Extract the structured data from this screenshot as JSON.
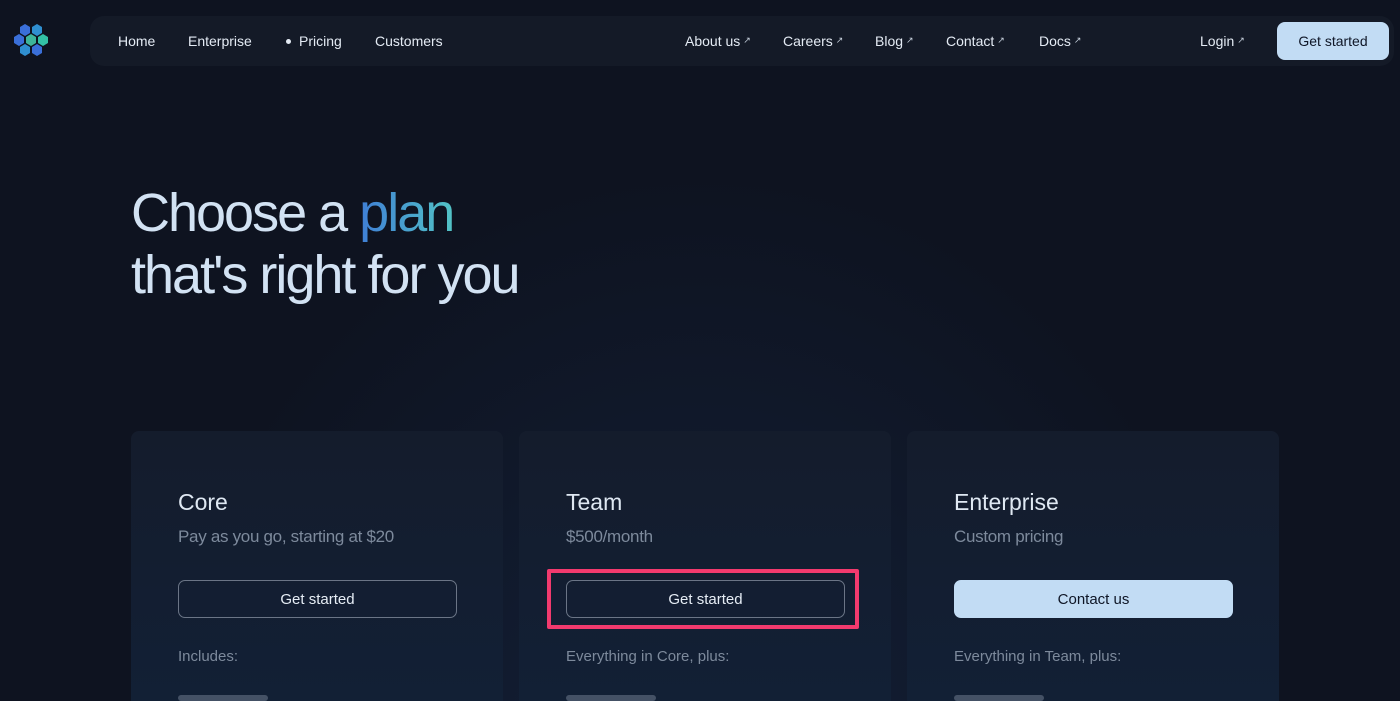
{
  "nav": {
    "left_items": [
      {
        "label": "Home"
      },
      {
        "label": "Enterprise"
      },
      {
        "label": "Pricing"
      },
      {
        "label": "Customers"
      }
    ],
    "right_items": [
      {
        "label": "About us"
      },
      {
        "label": "Careers"
      },
      {
        "label": "Blog"
      },
      {
        "label": "Contact"
      },
      {
        "label": "Docs"
      }
    ],
    "login": "Login",
    "external_arrow": "↗",
    "cta": "Get started"
  },
  "hero": {
    "line1_prefix": "Choose a ",
    "line1_accent": "plan",
    "line2": "that's right for you"
  },
  "plans": [
    {
      "title": "Core",
      "price": "Pay as you go, starting at $20",
      "button": "Get started",
      "includes": "Includes:"
    },
    {
      "title": "Team",
      "price": "$500/month",
      "button": "Get started",
      "includes": "Everything in Core, plus:"
    },
    {
      "title": "Enterprise",
      "price": "Custom pricing",
      "button": "Contact us",
      "includes": "Everything in Team, plus:"
    }
  ],
  "colors": {
    "background": "#0e1320",
    "accent_start": "#3f7ed6",
    "accent_end": "#52c3c6",
    "button_light": "#c2dcf4",
    "highlight": "#f23a6e"
  }
}
